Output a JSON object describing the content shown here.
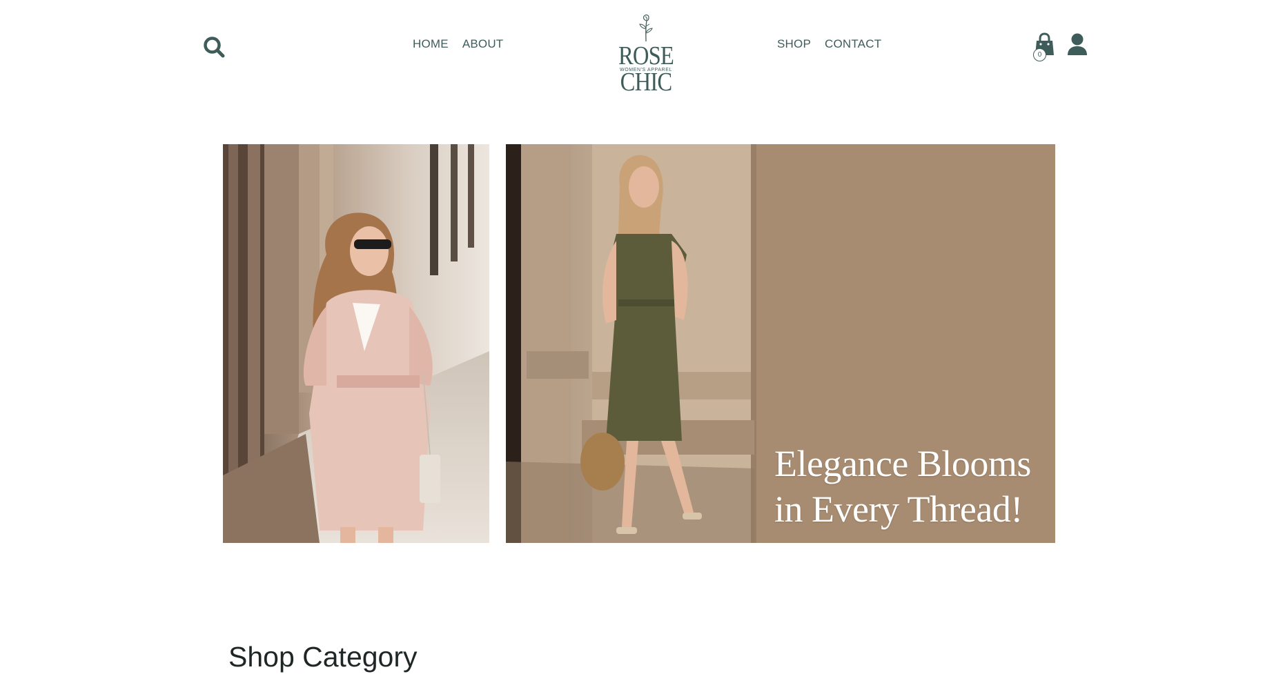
{
  "brand": {
    "name": "ROSE CHIC",
    "tagline": "WOMEN'S APPAREL",
    "color": "#3e5c5a"
  },
  "nav": {
    "left": [
      {
        "label": "HOME"
      },
      {
        "label": "ABOUT"
      }
    ],
    "right": [
      {
        "label": "SHOP"
      },
      {
        "label": "CONTACT"
      }
    ]
  },
  "header_icons": {
    "search": "search-icon",
    "cart": "shopping-bag-icon",
    "account": "user-icon",
    "cart_count": "0"
  },
  "hero": {
    "left_image": "woman in pink coat with sunglasses",
    "right_image": "woman in olive dress by stone columns",
    "tagline_line1": "Elegance Blooms",
    "tagline_line2": "in Every Thread!"
  },
  "sections": {
    "shop_category_title": "Shop Category"
  }
}
